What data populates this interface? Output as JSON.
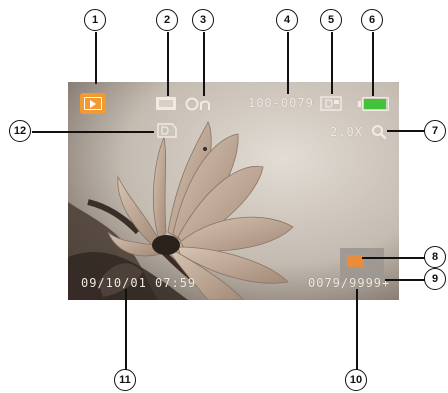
{
  "osd": {
    "file_number": "100-0079",
    "zoom_level": "2.0X",
    "datetime": "09/10/01 07:59",
    "image_counter": "0079/9999+",
    "battery_level": 1.0
  },
  "icons": {
    "playback_mode": "playback-icon",
    "voice_memo": "voice-memo-icon",
    "protect": "protect-icon",
    "dpof": "dpof-icon",
    "battery": "battery-icon",
    "print_order": "print-order-icon",
    "zoom": "zoom-icon",
    "zoom_navigator": "zoom-navigator-box"
  },
  "callouts": [
    "1",
    "2",
    "3",
    "4",
    "5",
    "6",
    "7",
    "8",
    "9",
    "10",
    "11",
    "12"
  ],
  "colors": {
    "playback_accent": "#f39a32",
    "battery_fill": "#44c23a",
    "osd_text": "#f1ebe3",
    "navigator_frame": "#9e9892",
    "navigator_view": "#ee8a34"
  }
}
